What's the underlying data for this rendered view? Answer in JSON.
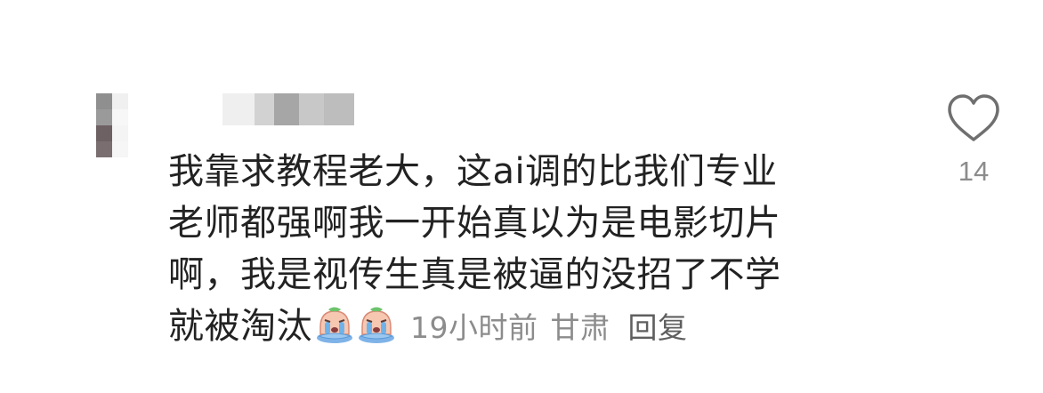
{
  "comment": {
    "avatar": {
      "icon": "avatar-pixelated-icon",
      "colors": [
        "#8f8f8f",
        "#f0f0f0",
        "#6d6163",
        "#f4f4f4"
      ]
    },
    "username": {
      "colors": [
        "#efefef",
        "#d2d2d2",
        "#a6a6a6",
        "#c8c8c8",
        "#bdbdbd"
      ]
    },
    "text_lines": [
      "我靠求教程老大，这ai调的比我们专业",
      "老师都强啊我一开始真以为是电影切片",
      "啊，我是视传生真是被逼的没招了不学",
      "就被淘汰"
    ],
    "emoji_icon": "crying-face-emoji-icon",
    "emoji_count": 2,
    "time": "19小时前",
    "location": "甘肃",
    "reply_label": "回复",
    "like": {
      "icon": "heart-outline-icon",
      "count": "14"
    }
  }
}
